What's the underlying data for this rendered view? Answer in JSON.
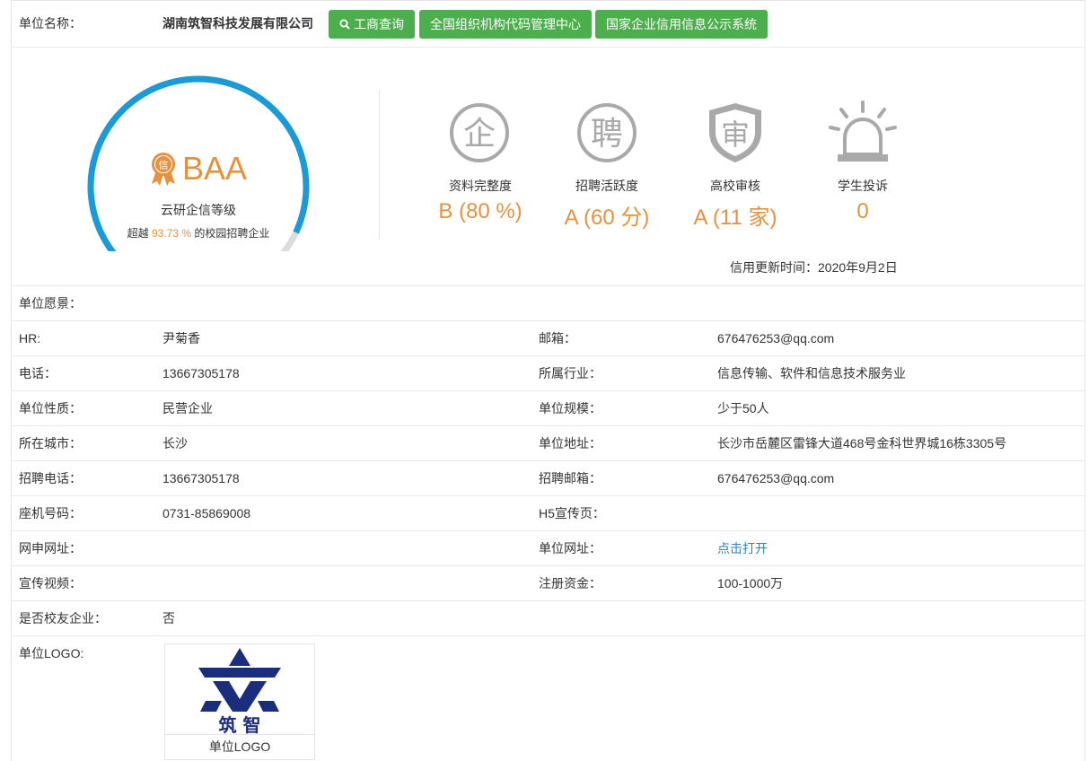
{
  "header": {
    "company_label": "单位名称：",
    "company_name": "湖南筑智科技发展有限公司",
    "buttons": [
      "工商查询",
      "全国组织机构代码管理中心",
      "国家企业信用信息公示系统"
    ]
  },
  "credit": {
    "grade": "BAA",
    "badge_char": "信",
    "grade_label": "云研企信等级",
    "exceed_prefix": "超越",
    "exceed_value": "93.73 %",
    "exceed_suffix": "的校园招聘企业",
    "gauge_fraction": 0.9373,
    "update_time": "信用更新时间：2020年9月2日",
    "metrics": [
      {
        "icon_char": "企",
        "label": "资料完整度",
        "value": "B (80 %)"
      },
      {
        "icon_char": "聘",
        "label": "招聘活跃度",
        "value": "A (60 分)"
      },
      {
        "icon_char": "审",
        "label": "高校审核",
        "value": "A (11 家)"
      },
      {
        "icon_char": "",
        "label": "学生投诉",
        "value": "0"
      }
    ]
  },
  "colors": {
    "accent": "#e6913d",
    "gauge": "#1a9ad6",
    "button": "#4cae4c",
    "link": "#2f7fc1"
  },
  "rows": [
    {
      "l1": "单位愿景：",
      "v1": "",
      "l2": "",
      "v2": ""
    },
    {
      "l1": "HR:",
      "v1": "尹菊香",
      "l2": "邮箱：",
      "v2": "676476253@qq.com"
    },
    {
      "l1": "电话：",
      "v1": "13667305178",
      "l2": "所属行业：",
      "v2": "信息传输、软件和信息技术服务业"
    },
    {
      "l1": "单位性质：",
      "v1": "民营企业",
      "l2": "单位规模：",
      "v2": "少于50人"
    },
    {
      "l1": "所在城市：",
      "v1": "长沙",
      "l2": "单位地址：",
      "v2": "长沙市岳麓区雷锋大道468号金科世界城16栋3305号"
    },
    {
      "l1": "招聘电话：",
      "v1": "13667305178",
      "l2": "招聘邮箱：",
      "v2": "676476253@qq.com"
    },
    {
      "l1": "座机号码：",
      "v1": "0731-85869008",
      "l2": "H5宣传页：",
      "v2": ""
    },
    {
      "l1": "网申网址：",
      "v1": "",
      "l2": "单位网址：",
      "v2": "点击打开"
    },
    {
      "l1": "宣传视频：",
      "v1": "",
      "l2": "注册资金：",
      "v2": "100-1000万"
    },
    {
      "l1": "是否校友企业：",
      "v1": "否",
      "l2": "",
      "v2": ""
    }
  ],
  "logo": {
    "label": "单位LOGO:",
    "caption": "单位LOGO",
    "mark_text": "筑 智"
  }
}
